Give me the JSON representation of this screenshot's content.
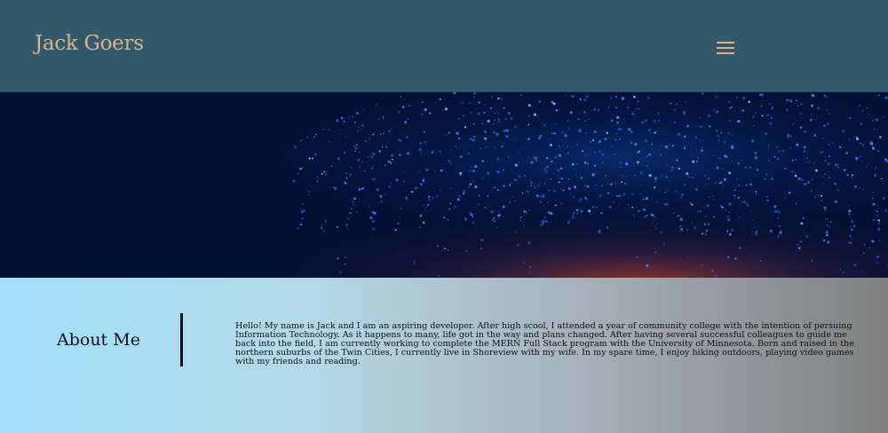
{
  "header": {
    "brand": "Jack Goers",
    "menu_icon": "hamburger-menu-icon"
  },
  "hero": {
    "image": "digital-particle-wave-background",
    "colors": {
      "background": "#020f33",
      "particle": "#3d7cff",
      "glow": "#c0431f"
    }
  },
  "about": {
    "title": "About Me",
    "text": "Hello! My name is Jack and I am an aspiring developer. After high scool, I attended a year of community college with the intention of persuing Information Technology. As it happens to many, life got in the way and plans changed. After having several successful colleagues to guide me back into the field, I am currently working to complete the MERN Full Stack program with the University of Minnesota. Born and raised in the northern suburbs of the Twin Cities, I currently live in Shoreview with my wife. In my spare time, I enjoy hiking outdoors, playing video games with my friends and reading."
  },
  "colors": {
    "header_bg": "#325a6b",
    "brand_accent": "#d9b48b",
    "about_gradient_start": "#9fe0fb",
    "about_gradient_end": "#808080"
  }
}
